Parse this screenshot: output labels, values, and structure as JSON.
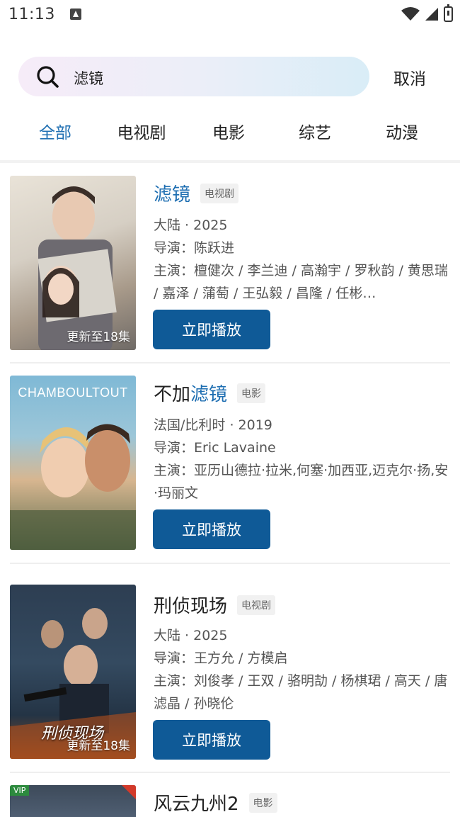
{
  "status_bar": {
    "time": "11:13"
  },
  "search": {
    "query": "滤镜",
    "cancel_label": "取消"
  },
  "tabs": [
    {
      "label": "全部",
      "active": true
    },
    {
      "label": "电视剧",
      "active": false
    },
    {
      "label": "电影",
      "active": false
    },
    {
      "label": "综艺",
      "active": false
    },
    {
      "label": "动漫",
      "active": false
    }
  ],
  "results": [
    {
      "title_pre": "",
      "title_hl": "滤镜",
      "title_post": "",
      "type": "电视剧",
      "region_year": "大陆 · 2025",
      "director": "导演：陈跃进",
      "cast": "主演：檀健次 / 李兰迪 / 高瀚宇 / 罗秋韵 / 黄思瑞 / 嘉泽 / 蒲萄 / 王弘毅 / 昌隆 / 任彬…",
      "poster_badge": "更新至18集",
      "play_label": "立即播放"
    },
    {
      "title_pre": "不加",
      "title_hl": "滤镜",
      "title_post": "",
      "type": "电影",
      "region_year": "法国/比利时 · 2019",
      "director": "导演：Eric Lavaine",
      "cast": "主演：亚历山德拉·拉米,何塞·加西亚,迈克尔·扬,安·玛丽文",
      "poster_title": "CHAMBOULTOUT",
      "play_label": "立即播放"
    },
    {
      "title_pre": "刑侦现场",
      "title_hl": "",
      "title_post": "",
      "type": "电视剧",
      "region_year": "大陆 · 2025",
      "director": "导演：王方允 / 方模启",
      "cast": "主演：刘俊孝 / 王双 / 骆明劼 / 杨棋珺 / 高天 / 唐滤晶 / 孙晓伦",
      "poster_title": "刑侦现场",
      "poster_badge": "更新至18集",
      "play_label": "立即播放"
    },
    {
      "title_pre": "风云九州2",
      "title_hl": "",
      "title_post": "",
      "type": "电影",
      "poster_badge": "VIP"
    }
  ],
  "colors": {
    "accent": "#1f6fb2",
    "play_button": "#0f5a97"
  }
}
